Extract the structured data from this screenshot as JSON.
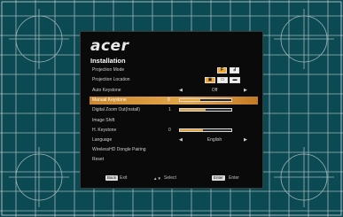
{
  "osd": {
    "logo": "acer",
    "title": "Installation",
    "rows": [
      {
        "label": "Projection Mode",
        "kind": "icons"
      },
      {
        "label": "Projection Location",
        "kind": "icons"
      },
      {
        "label": "Auto Keystone",
        "kind": "option",
        "value": "Off"
      },
      {
        "label": "Manual Keystone",
        "kind": "slider",
        "number": "0",
        "fill": 0.4,
        "selected": true
      },
      {
        "label": "Digital Zoom Out(Install)",
        "kind": "slider",
        "number": "1",
        "fill": 0.5
      },
      {
        "label": "Image Shift",
        "kind": "none"
      },
      {
        "label": "H. Keystone",
        "kind": "slider",
        "number": "0",
        "fill": 0.45
      },
      {
        "label": "Language",
        "kind": "option",
        "value": "English"
      },
      {
        "label": "WirelessHD Dongle Pairing",
        "kind": "none"
      },
      {
        "label": "Reset",
        "kind": "none"
      }
    ],
    "footer": {
      "back_key": "Back",
      "back_text": "Exit",
      "select_text": "Select",
      "enter_key": "Enter",
      "enter_text": "Enter"
    },
    "colors": {
      "accent": "#e1a33d",
      "background": "#0b4a52"
    }
  }
}
